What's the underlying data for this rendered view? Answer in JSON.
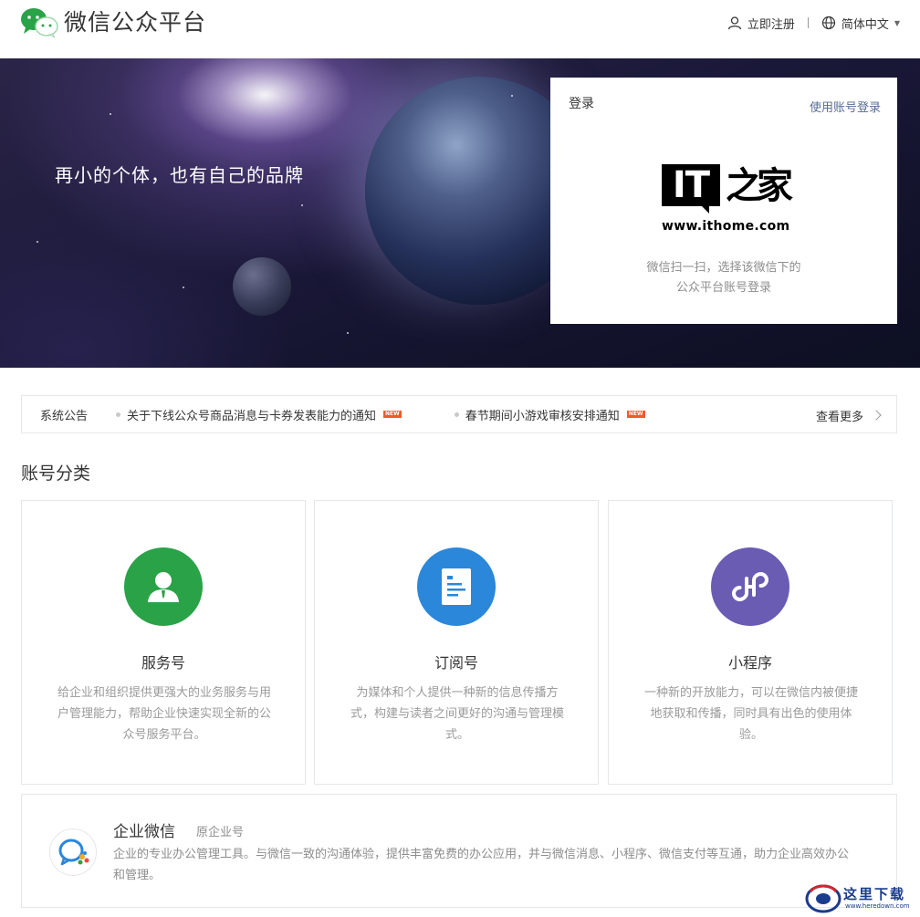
{
  "header": {
    "site_title": "微信公众平台",
    "register_label": "立即注册",
    "language_label": "简体中文"
  },
  "banner": {
    "slogan": "再小的个体，也有自己的品牌"
  },
  "login": {
    "title": "登录",
    "switch_label": "使用账号登录",
    "logo_text": "IT",
    "logo_site_name": "之家",
    "logo_url": "www.ithome.com",
    "desc_line1": "微信扫一扫，选择该微信下的",
    "desc_line2": "公众平台账号登录"
  },
  "notice": {
    "label": "系统公告",
    "items": [
      {
        "text": "关于下线公众号商品消息与卡券发表能力的通知",
        "badge": "NEW"
      },
      {
        "text": "春节期间小游戏审核安排通知",
        "badge": "NEW"
      }
    ],
    "more_label": "查看更多"
  },
  "section": {
    "title": "账号分类"
  },
  "cards": [
    {
      "title": "服务号",
      "desc": "给企业和组织提供更强大的业务服务与用户管理能力，帮助企业快速实现全新的公众号服务平台。",
      "color": "#2aa248"
    },
    {
      "title": "订阅号",
      "desc": "为媒体和个人提供一种新的信息传播方式，构建与读者之间更好的沟通与管理模式。",
      "color": "#2b87d9"
    },
    {
      "title": "小程序",
      "desc": "一种新的开放能力，可以在微信内被便捷地获取和传播，同时具有出色的使用体验。",
      "color": "#6a5bb3"
    }
  ],
  "enterprise": {
    "title": "企业微信",
    "subtitle": "原企业号",
    "desc": "企业的专业办公管理工具。与微信一致的沟通体验，提供丰富免费的办公应用，并与微信消息、小程序、微信支付等互通，助力企业高效办公和管理。"
  },
  "watermark": {
    "text": "这里下载",
    "url": "www.heredown.com"
  },
  "colors": {
    "brand_green": "#2aa248",
    "link_blue": "#576b95",
    "new_badge": "#f15a24"
  }
}
